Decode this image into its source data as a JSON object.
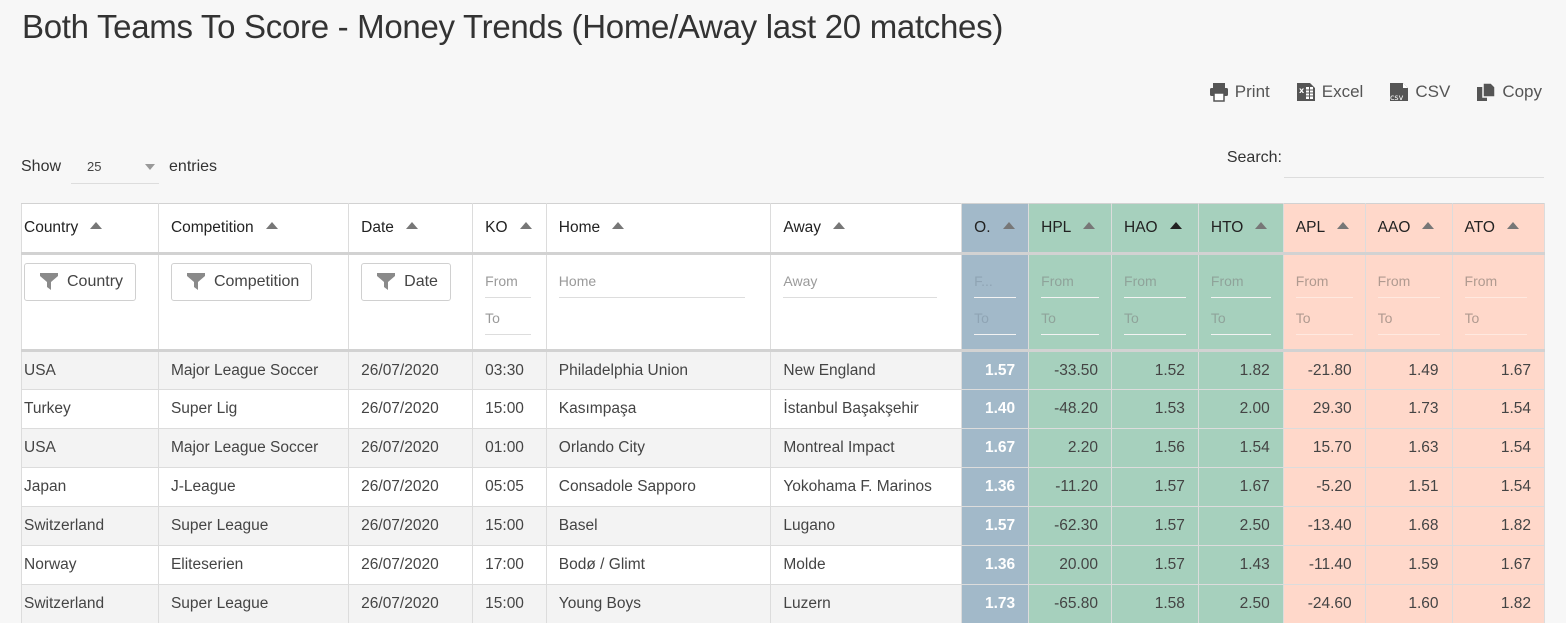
{
  "page": {
    "title": "Both Teams To Score - Money Trends (Home/Away last 20 matches)"
  },
  "export": {
    "print": {
      "label": "Print",
      "icon": "printer-icon"
    },
    "excel": {
      "label": "Excel",
      "icon": "excel-file-icon"
    },
    "csv": {
      "label": "CSV",
      "icon": "csv-file-icon"
    },
    "copy": {
      "label": "Copy",
      "icon": "copy-icon"
    }
  },
  "length": {
    "show_label": "Show",
    "value": "25",
    "entries_label": "entries"
  },
  "search": {
    "label": "Search:",
    "value": ""
  },
  "colors": {
    "odds_column": "#a2b9c9",
    "home_columns": "#a6d0bd",
    "away_columns": "#ffd8ca"
  },
  "columns": [
    {
      "key": "country",
      "label": "Country"
    },
    {
      "key": "competition",
      "label": "Competition"
    },
    {
      "key": "date",
      "label": "Date"
    },
    {
      "key": "ko",
      "label": "KO"
    },
    {
      "key": "home",
      "label": "Home"
    },
    {
      "key": "away",
      "label": "Away"
    },
    {
      "key": "o",
      "label": "O."
    },
    {
      "key": "hpl",
      "label": "HPL"
    },
    {
      "key": "hao",
      "label": "HAO"
    },
    {
      "key": "hto",
      "label": "HTO"
    },
    {
      "key": "apl",
      "label": "APL"
    },
    {
      "key": "aao",
      "label": "AAO"
    },
    {
      "key": "ato",
      "label": "ATO"
    }
  ],
  "filters": {
    "country": "Country",
    "competition": "Competition",
    "date": "Date",
    "home_placeholder": "Home",
    "away_placeholder": "Away",
    "from_placeholder": "From",
    "from_short_placeholder": "F...",
    "to_placeholder": "To"
  },
  "rows": [
    {
      "country": "USA",
      "competition": "Major League Soccer",
      "date": "26/07/2020",
      "ko": "03:30",
      "home": "Philadelphia Union",
      "away": "New England",
      "o": "1.57",
      "hpl": "-33.50",
      "hao": "1.52",
      "hto": "1.82",
      "apl": "-21.80",
      "aao": "1.49",
      "ato": "1.67"
    },
    {
      "country": "Turkey",
      "competition": "Super Lig",
      "date": "26/07/2020",
      "ko": "15:00",
      "home": "Kasımpaşa",
      "away": "İstanbul Başakşehir",
      "o": "1.40",
      "hpl": "-48.20",
      "hao": "1.53",
      "hto": "2.00",
      "apl": "29.30",
      "aao": "1.73",
      "ato": "1.54"
    },
    {
      "country": "USA",
      "competition": "Major League Soccer",
      "date": "26/07/2020",
      "ko": "01:00",
      "home": "Orlando City",
      "away": "Montreal Impact",
      "o": "1.67",
      "hpl": "2.20",
      "hao": "1.56",
      "hto": "1.54",
      "apl": "15.70",
      "aao": "1.63",
      "ato": "1.54"
    },
    {
      "country": "Japan",
      "competition": "J-League",
      "date": "26/07/2020",
      "ko": "05:05",
      "home": "Consadole Sapporo",
      "away": "Yokohama F. Marinos",
      "o": "1.36",
      "hpl": "-11.20",
      "hao": "1.57",
      "hto": "1.67",
      "apl": "-5.20",
      "aao": "1.51",
      "ato": "1.54"
    },
    {
      "country": "Switzerland",
      "competition": "Super League",
      "date": "26/07/2020",
      "ko": "15:00",
      "home": "Basel",
      "away": "Lugano",
      "o": "1.57",
      "hpl": "-62.30",
      "hao": "1.57",
      "hto": "2.50",
      "apl": "-13.40",
      "aao": "1.68",
      "ato": "1.82"
    },
    {
      "country": "Norway",
      "competition": "Eliteserien",
      "date": "26/07/2020",
      "ko": "17:00",
      "home": "Bodø / Glimt",
      "away": "Molde",
      "o": "1.36",
      "hpl": "20.00",
      "hao": "1.57",
      "hto": "1.43",
      "apl": "-11.40",
      "aao": "1.59",
      "ato": "1.67"
    },
    {
      "country": "Switzerland",
      "competition": "Super League",
      "date": "26/07/2020",
      "ko": "15:00",
      "home": "Young Boys",
      "away": "Luzern",
      "o": "1.73",
      "hpl": "-65.80",
      "hao": "1.58",
      "hto": "2.50",
      "apl": "-24.60",
      "aao": "1.60",
      "ato": "1.82"
    }
  ]
}
